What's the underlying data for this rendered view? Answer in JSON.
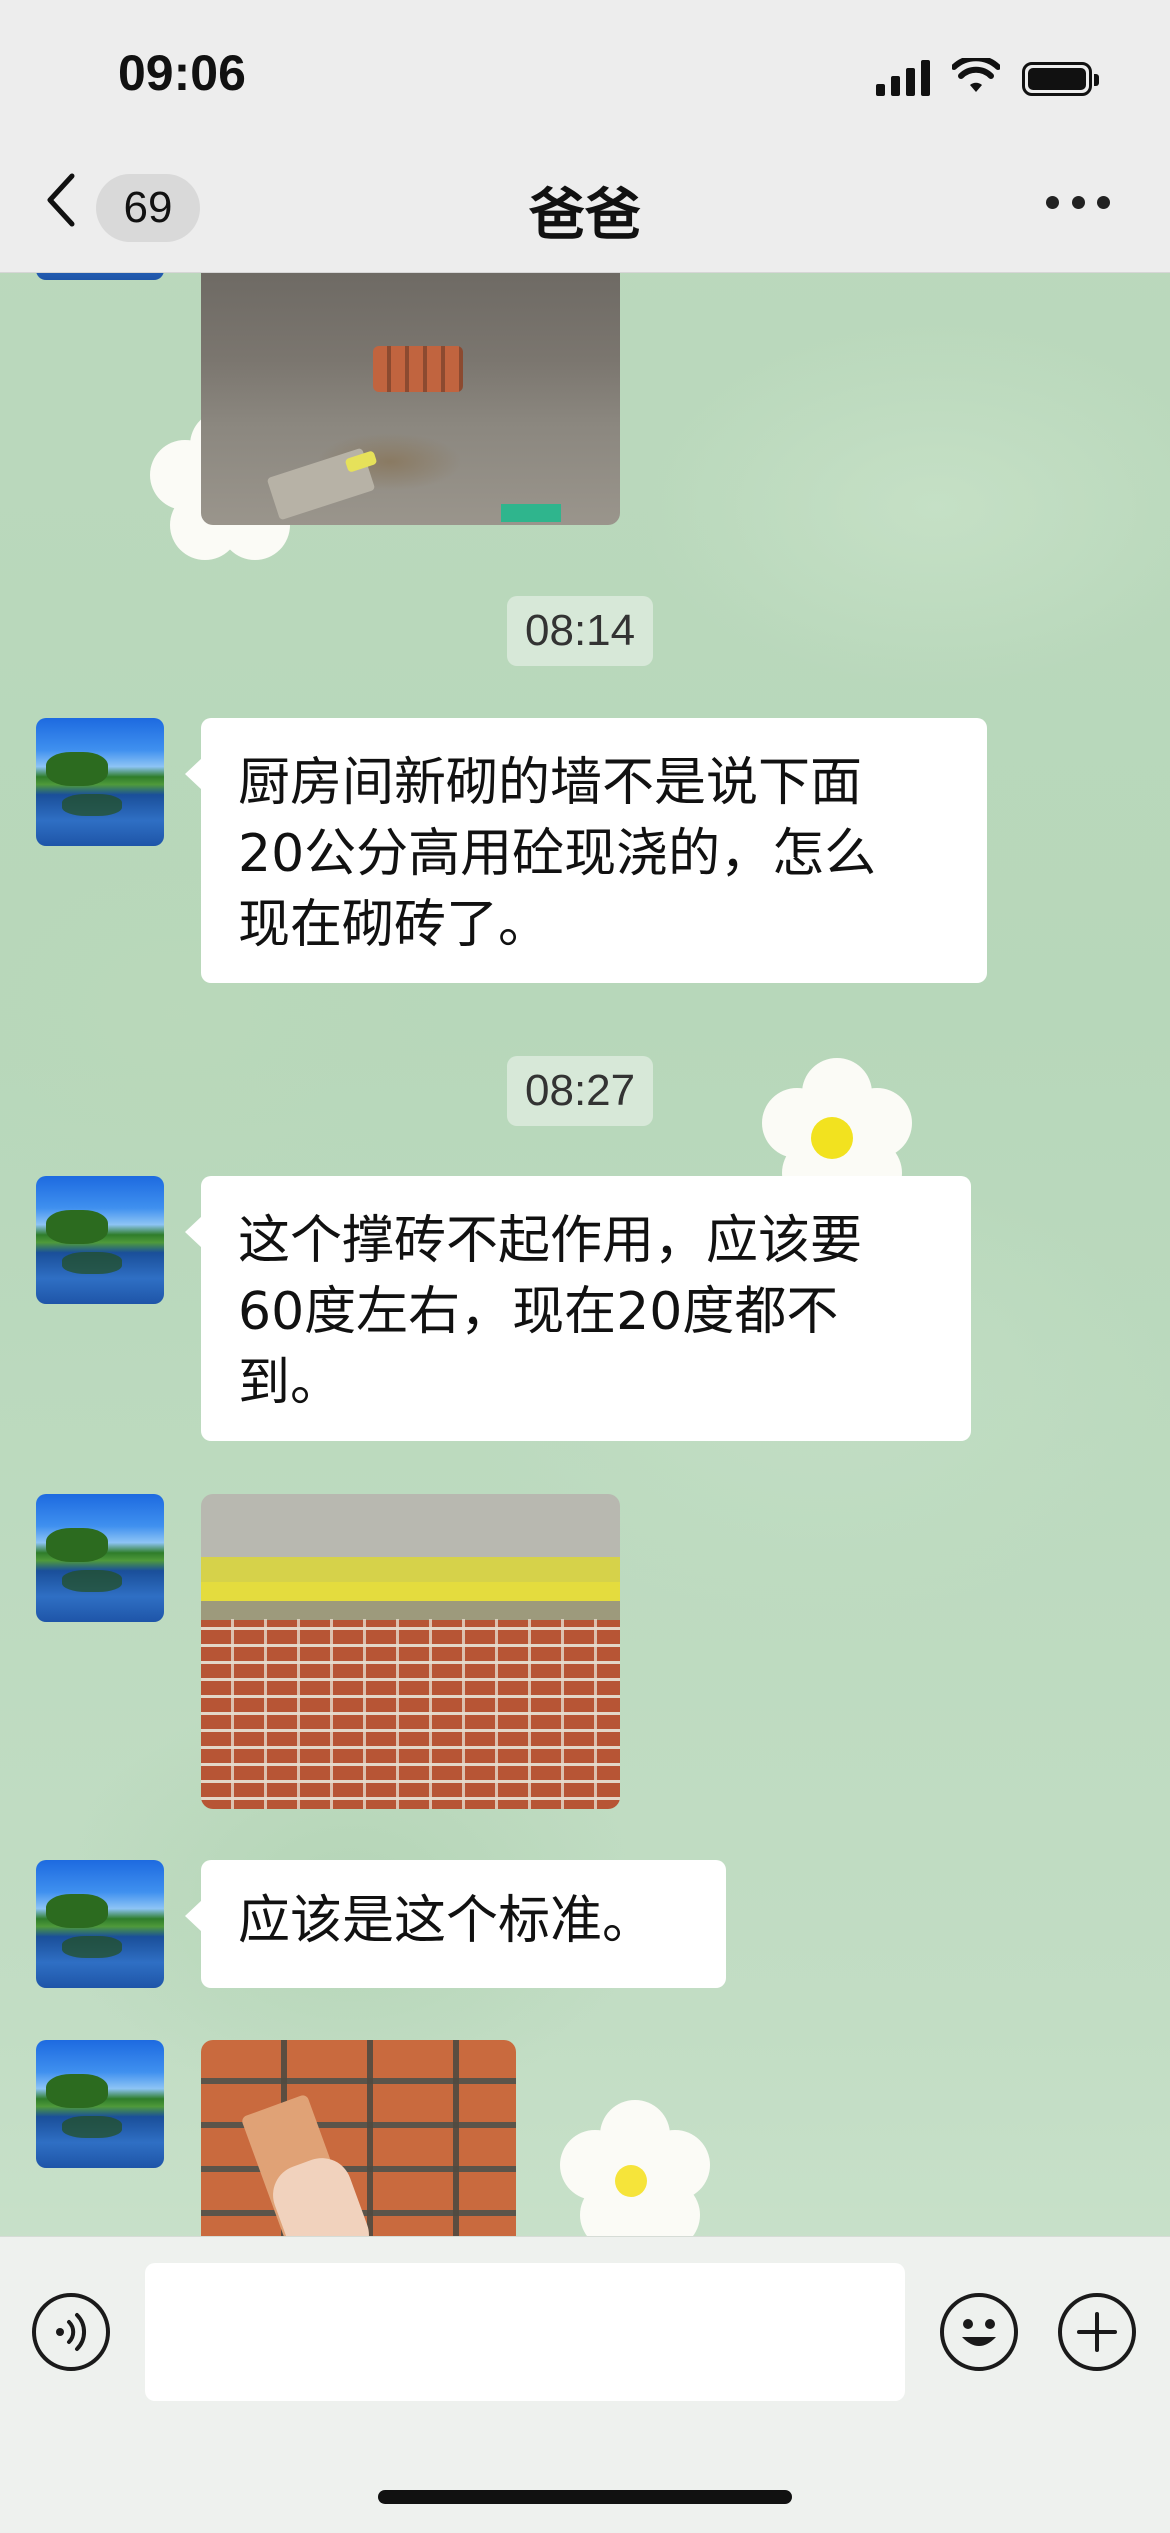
{
  "status_bar": {
    "time": "09:06"
  },
  "header": {
    "back_count": "69",
    "title": "爸爸"
  },
  "messages": {
    "ts1": "08:14",
    "msg1": "厨房间新砌的墙不是说下面\n20公分高用砼现浇的，怎么\n现在砌砖了。",
    "ts2": "08:27",
    "msg2": "这个撑砖不起作用，应该要\n60度左右，现在20度都不\n到。",
    "msg3": "应该是这个标准。"
  },
  "input": {
    "placeholder": ""
  },
  "icons": {
    "back": "chevron-left-icon",
    "more": "more-icon",
    "voice": "voice-icon",
    "emoji": "emoji-icon",
    "plus": "plus-icon"
  }
}
